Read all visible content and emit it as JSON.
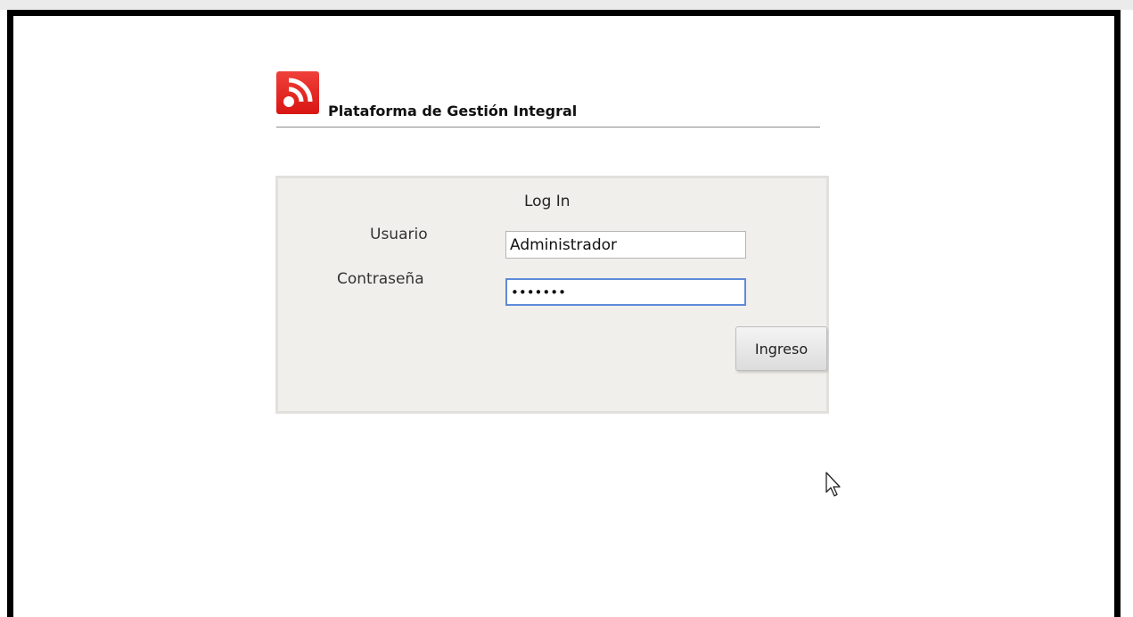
{
  "app": {
    "title": "Plataforma de Gestión Integral",
    "logo_icon": "rss-icon",
    "brand_color": "#e0201a"
  },
  "login": {
    "heading": "Log In",
    "username_label": "Usuario",
    "username_value": "Administrador",
    "password_label": "Contraseña",
    "password_value": "•••••••",
    "submit_label": "Ingreso"
  },
  "colors": {
    "panel_bg": "#f1efec",
    "focus_border": "#5f8ad8"
  }
}
